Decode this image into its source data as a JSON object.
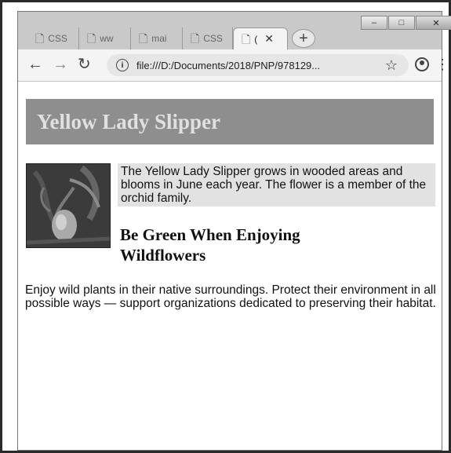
{
  "browser": {
    "tabs": [
      {
        "label": "CSS",
        "active": false
      },
      {
        "label": "ww",
        "active": false
      },
      {
        "label": "mai",
        "active": false
      },
      {
        "label": "CSS",
        "active": false
      },
      {
        "label": "(",
        "active": true
      }
    ],
    "new_tab_symbol": "+",
    "window_controls": {
      "minimize": "–",
      "maximize": "□",
      "close": "✕"
    },
    "url": "file:///D:/Documents/2018/PNP/978129..."
  },
  "page": {
    "title": "Yellow Lady Slipper",
    "intro": "The Yellow Lady Slipper grows in wooded areas and blooms in June each year. The flower is a member of the orchid family.",
    "heading": "Be Green When Enjoying Wildflowers",
    "body": "Enjoy wild plants in their native surroundings. Protect their environment in all possible ways — support organizations dedicated to preserving their habitat."
  }
}
